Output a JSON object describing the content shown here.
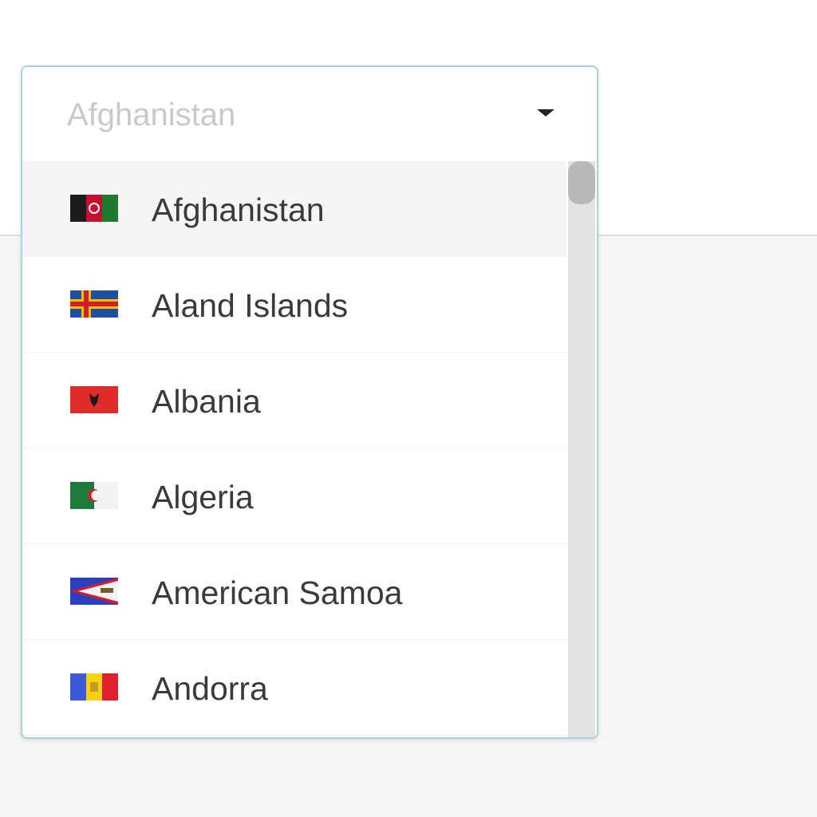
{
  "select": {
    "value": "Afghanistan",
    "caret_icon": "caret-down-icon"
  },
  "options": [
    {
      "label": "Afghanistan",
      "flag": "flag-afghanistan-icon",
      "highlighted": true
    },
    {
      "label": "Aland Islands",
      "flag": "flag-aland-islands-icon",
      "highlighted": false
    },
    {
      "label": "Albania",
      "flag": "flag-albania-icon",
      "highlighted": false
    },
    {
      "label": "Algeria",
      "flag": "flag-algeria-icon",
      "highlighted": false
    },
    {
      "label": "American Samoa",
      "flag": "flag-american-samoa-icon",
      "highlighted": false
    },
    {
      "label": "Andorra",
      "flag": "flag-andorra-icon",
      "highlighted": false
    }
  ],
  "colors": {
    "dropdown_border": "#a8d2df",
    "placeholder_text": "#c9c9c9",
    "option_text": "#3a3a3a",
    "highlight_bg": "#f5f5f5",
    "page_bg": "#f6f6f6"
  }
}
